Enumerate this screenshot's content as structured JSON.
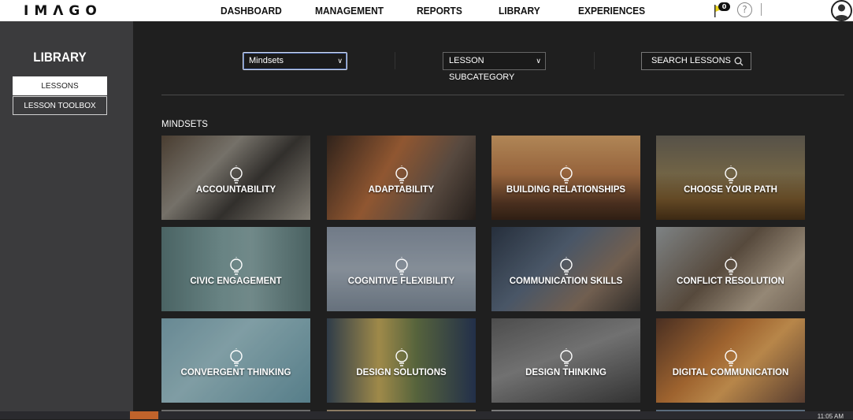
{
  "header": {
    "logo": "IMΛGO",
    "nav": [
      "DASHBOARD",
      "MANAGEMENT",
      "REPORTS",
      "LIBRARY",
      "EXPERIENCES"
    ],
    "notification_count": "0",
    "help_label": "?"
  },
  "sidebar": {
    "title": "LIBRARY",
    "items": [
      {
        "label": "LESSONS",
        "active": true
      },
      {
        "label": "LESSON TOOLBOX",
        "active": false
      }
    ]
  },
  "filters": {
    "category_value": "Mindsets",
    "subcategory_value": "LESSON SUBCATEGORY",
    "search_placeholder": "SEARCH LESSONS"
  },
  "section": {
    "title": "MINDSETS"
  },
  "cards": [
    {
      "label": "ACCOUNTABILITY"
    },
    {
      "label": "ADAPTABILITY"
    },
    {
      "label": "BUILDING RELATIONSHIPS"
    },
    {
      "label": "CHOOSE YOUR PATH"
    },
    {
      "label": "CIVIC ENGAGEMENT"
    },
    {
      "label": "COGNITIVE FLEXIBILITY"
    },
    {
      "label": "COMMUNICATION SKILLS"
    },
    {
      "label": "CONFLICT RESOLUTION"
    },
    {
      "label": "CONVERGENT THINKING"
    },
    {
      "label": "DESIGN SOLUTIONS"
    },
    {
      "label": "DESIGN THINKING"
    },
    {
      "label": "DIGITAL COMMUNICATION"
    }
  ],
  "taskbar": {
    "clock": "11:05 AM"
  },
  "colors": {
    "page_bg": "#1f1f1f",
    "sidebar_bg": "#3b3b3d",
    "topbar_bg": "#ffffff",
    "notif_flag": "#e8d21a"
  }
}
